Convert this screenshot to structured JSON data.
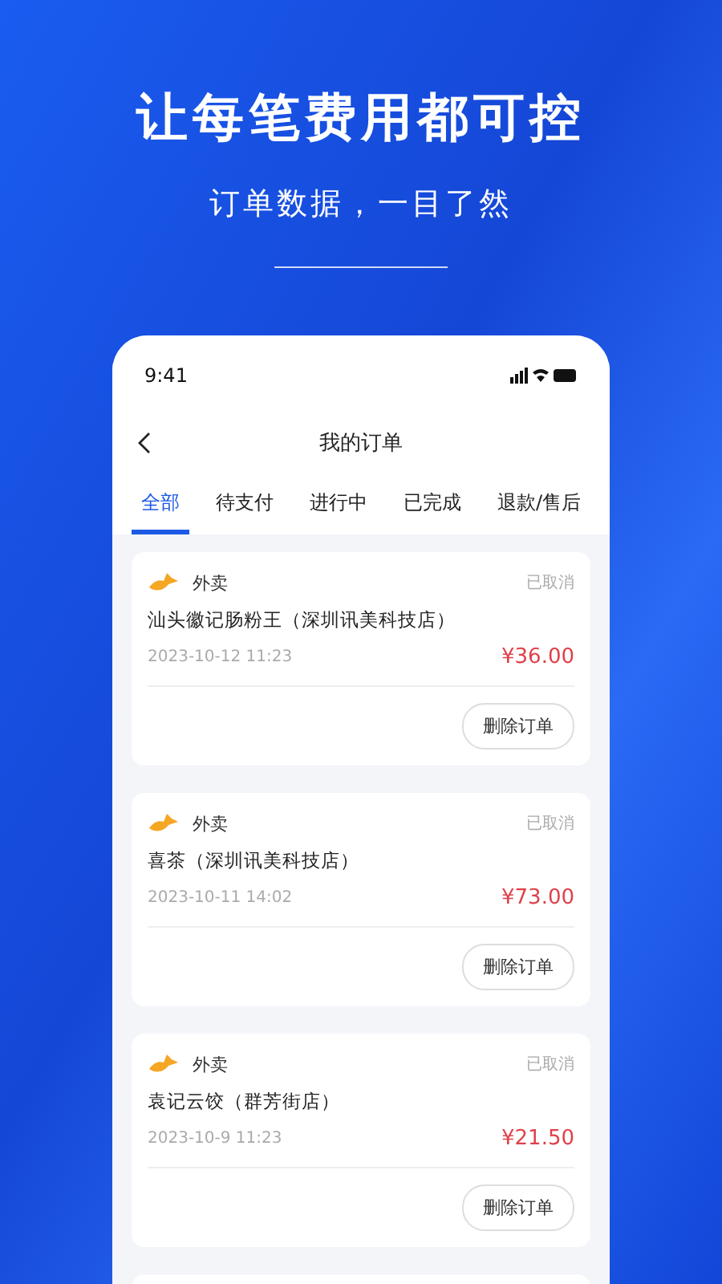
{
  "headline": "让每笔费用都可控",
  "subtitle": "订单数据，一目了然",
  "phone": {
    "time": "9:41",
    "title": "我的订单",
    "tabs": [
      {
        "label": "全部",
        "selected": true
      },
      {
        "label": "待支付",
        "selected": false
      },
      {
        "label": "进行中",
        "selected": false
      },
      {
        "label": "已完成",
        "selected": false
      },
      {
        "label": "退款/售后",
        "selected": false
      }
    ],
    "orders": [
      {
        "category": "外卖",
        "status": "已取消",
        "shop": "汕头徽记肠粉王（深圳讯美科技店）",
        "time": "2023-10-12 11:23",
        "price": "¥36.00",
        "action": "删除订单"
      },
      {
        "category": "外卖",
        "status": "已取消",
        "shop": "喜茶（深圳讯美科技店）",
        "time": "2023-10-11 14:02",
        "price": "¥73.00",
        "action": "删除订单"
      },
      {
        "category": "外卖",
        "status": "已取消",
        "shop": "袁记云饺（群芳街店）",
        "time": "2023-10-9 11:23",
        "price": "¥21.50",
        "action": "删除订单"
      }
    ]
  }
}
